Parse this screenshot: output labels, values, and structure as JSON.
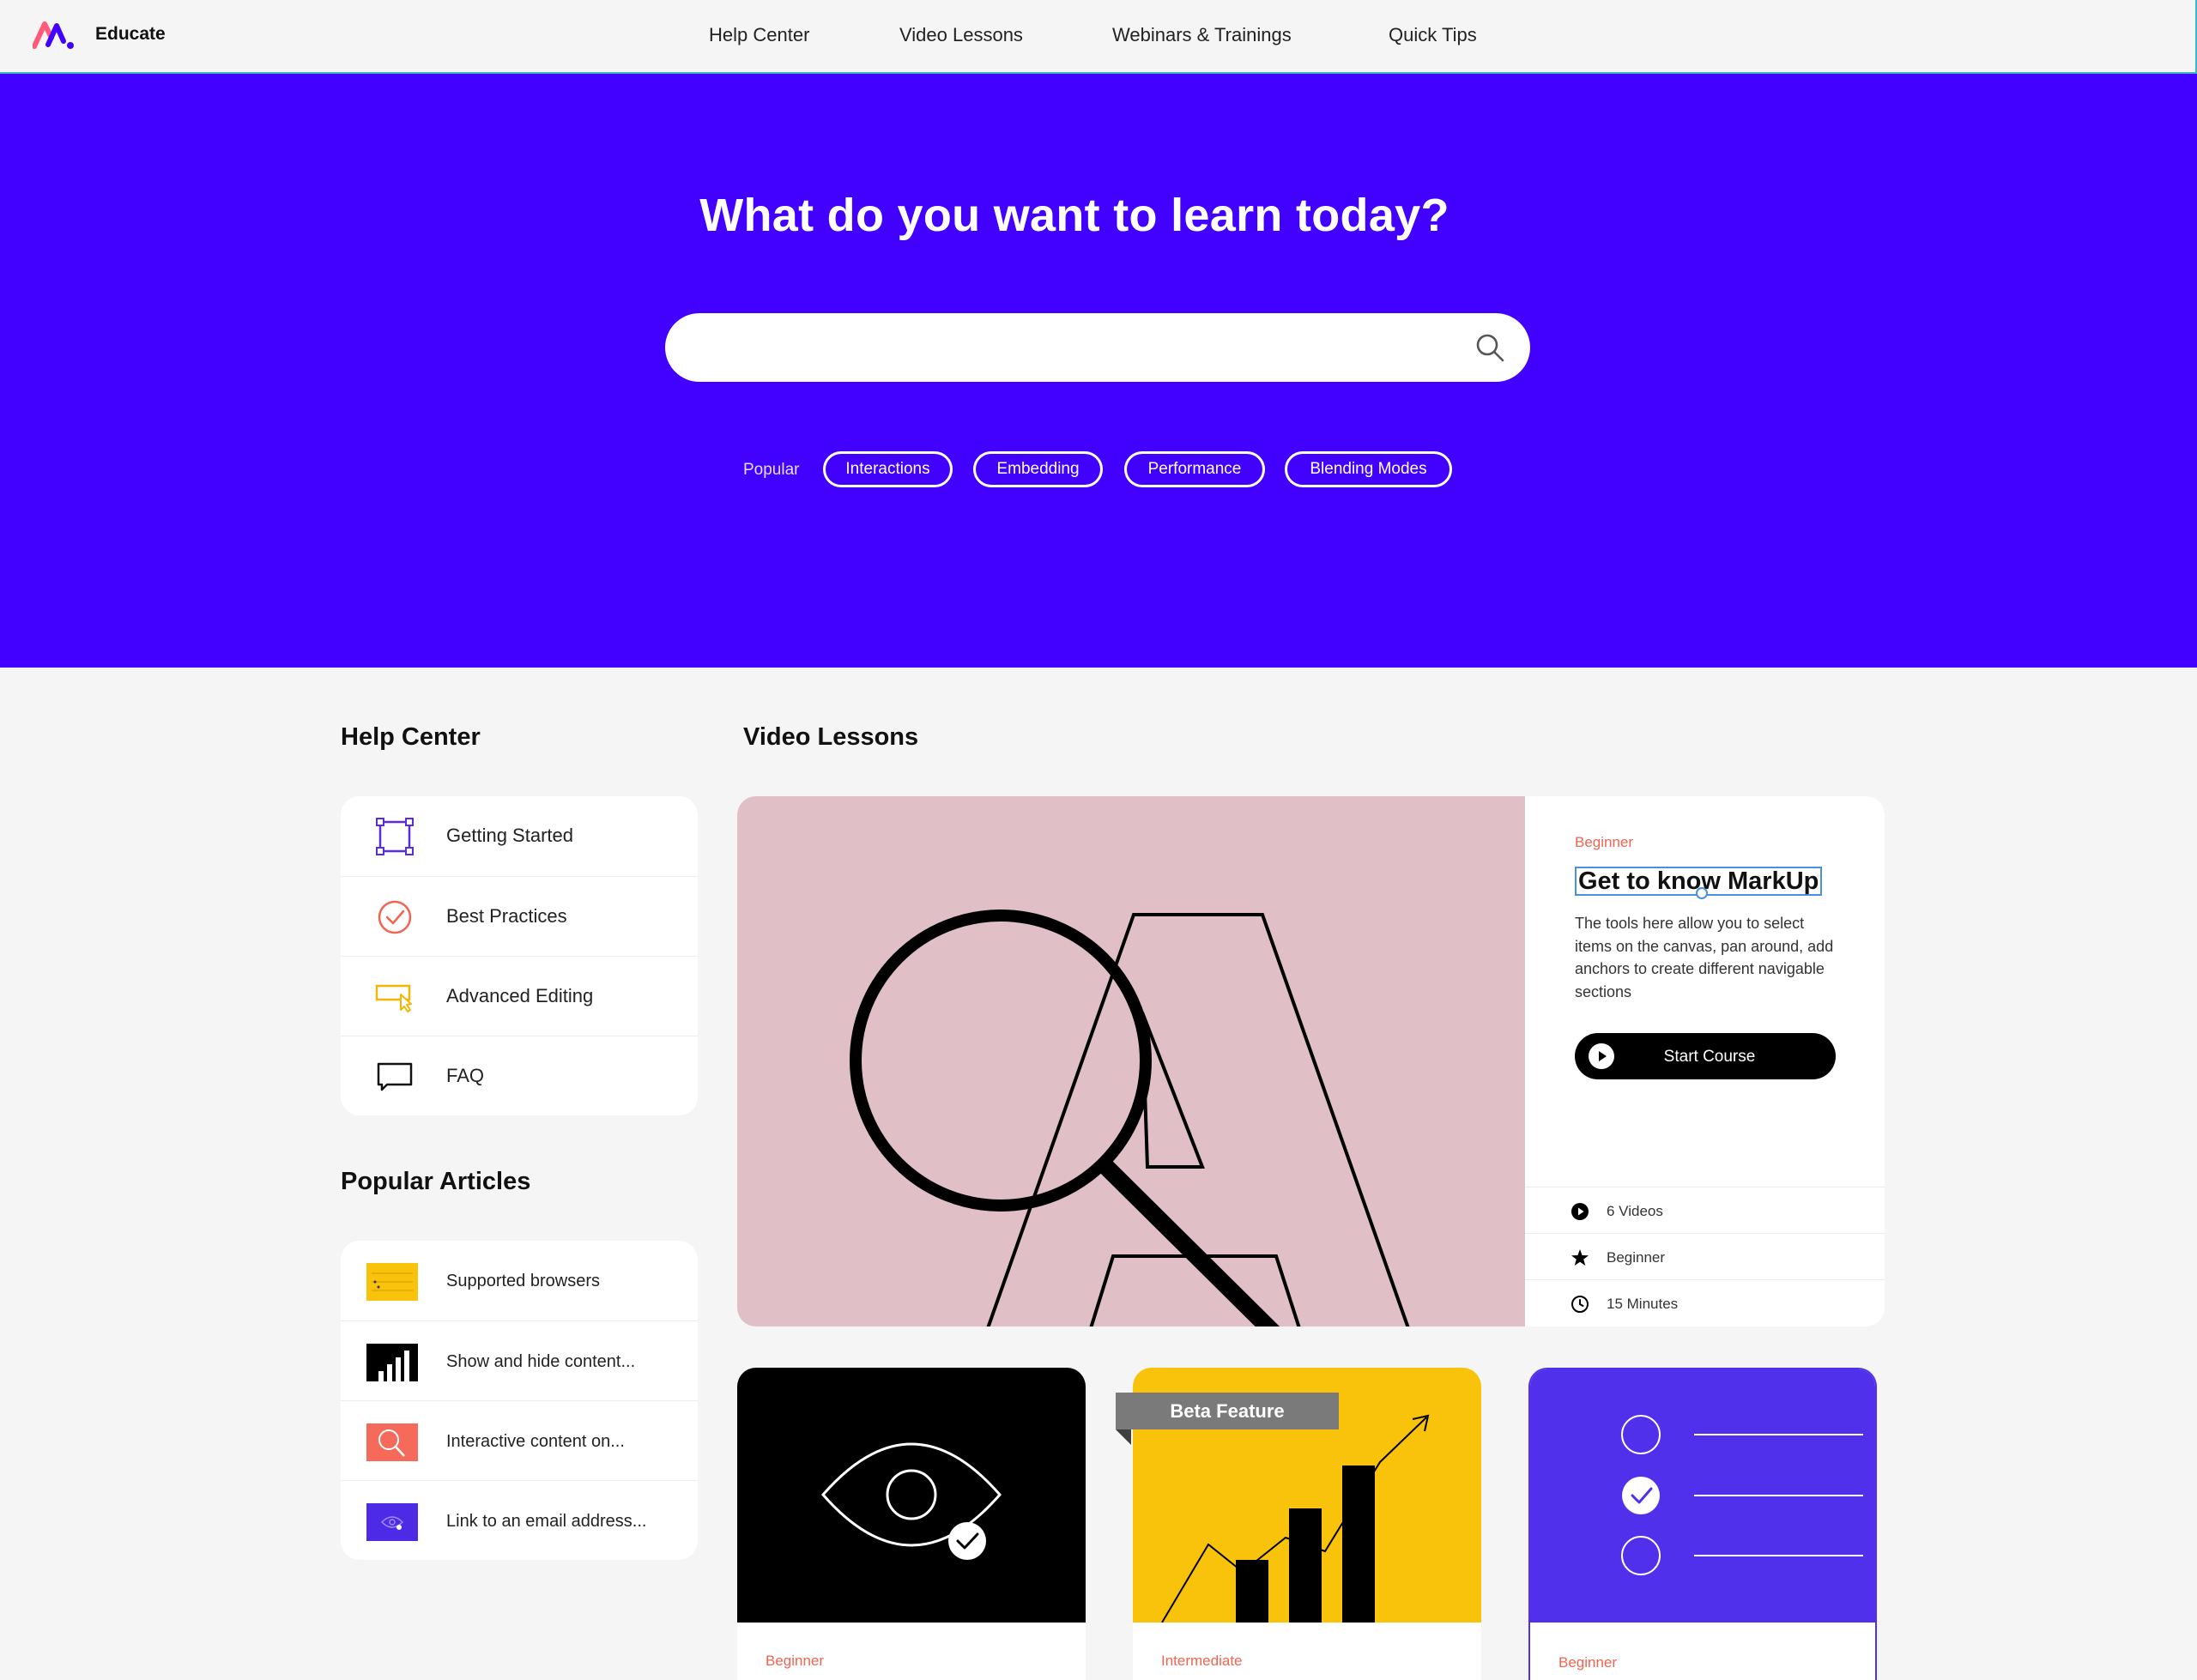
{
  "brand": {
    "name": "Educate",
    "logo_icon": "markup-logo-icon"
  },
  "nav": {
    "items": [
      "Help Center",
      "Video Lessons",
      "Webinars & Trainings",
      "Quick Tips"
    ]
  },
  "hero": {
    "title": "What do you want to learn today?",
    "search": {
      "value": "",
      "placeholder": "",
      "icon": "search-icon"
    },
    "popular_label": "Popular",
    "popular_tags": [
      "Interactions",
      "Embedding",
      "Performance",
      "Blending Modes"
    ],
    "background": "#4200ff"
  },
  "help_center": {
    "title": "Help Center",
    "items": [
      {
        "label": "Getting Started",
        "icon": "frame-select-icon"
      },
      {
        "label": "Best Practices",
        "icon": "check-circle-icon"
      },
      {
        "label": "Advanced Editing",
        "icon": "cursor-box-icon"
      },
      {
        "label": "FAQ",
        "icon": "speech-bubble-icon"
      }
    ]
  },
  "popular_articles": {
    "title": "Popular Articles",
    "items": [
      {
        "label": "Supported browsers",
        "thumb": "yellow-notes-thumbnail"
      },
      {
        "label": "Show and hide content...",
        "thumb": "bar-chart-thumbnail"
      },
      {
        "label": "Interactive content on...",
        "thumb": "magnifier-thumbnail"
      },
      {
        "label": "Link to an email address...",
        "thumb": "eye-thumbnail"
      }
    ]
  },
  "video_lessons": {
    "title": "Video Lessons",
    "featured": {
      "level": "Beginner",
      "title": "Get to know MarkUp",
      "description": "The tools here allow you to select items on the canvas, pan around, add anchors to create different navigable sections",
      "button": "Start Course",
      "meta": [
        {
          "label": "6 Videos",
          "icon": "play-circle-icon"
        },
        {
          "label": "Beginner",
          "icon": "star-icon"
        },
        {
          "label": "15 Minutes",
          "icon": "clock-icon"
        }
      ]
    },
    "cards": [
      {
        "level": "Beginner",
        "art": "eye-check-illustration",
        "badge": ""
      },
      {
        "level": "Intermediate",
        "art": "bar-chart-illustration",
        "badge": "Beta Feature"
      },
      {
        "level": "Beginner",
        "art": "checklist-illustration",
        "badge": ""
      }
    ]
  },
  "colors": {
    "accent": "#4200ff",
    "level_text": "#f2644f",
    "feature_art_bg": "#e0c0c6",
    "yellow": "#f9c20b",
    "purple_card": "#5030ea"
  }
}
